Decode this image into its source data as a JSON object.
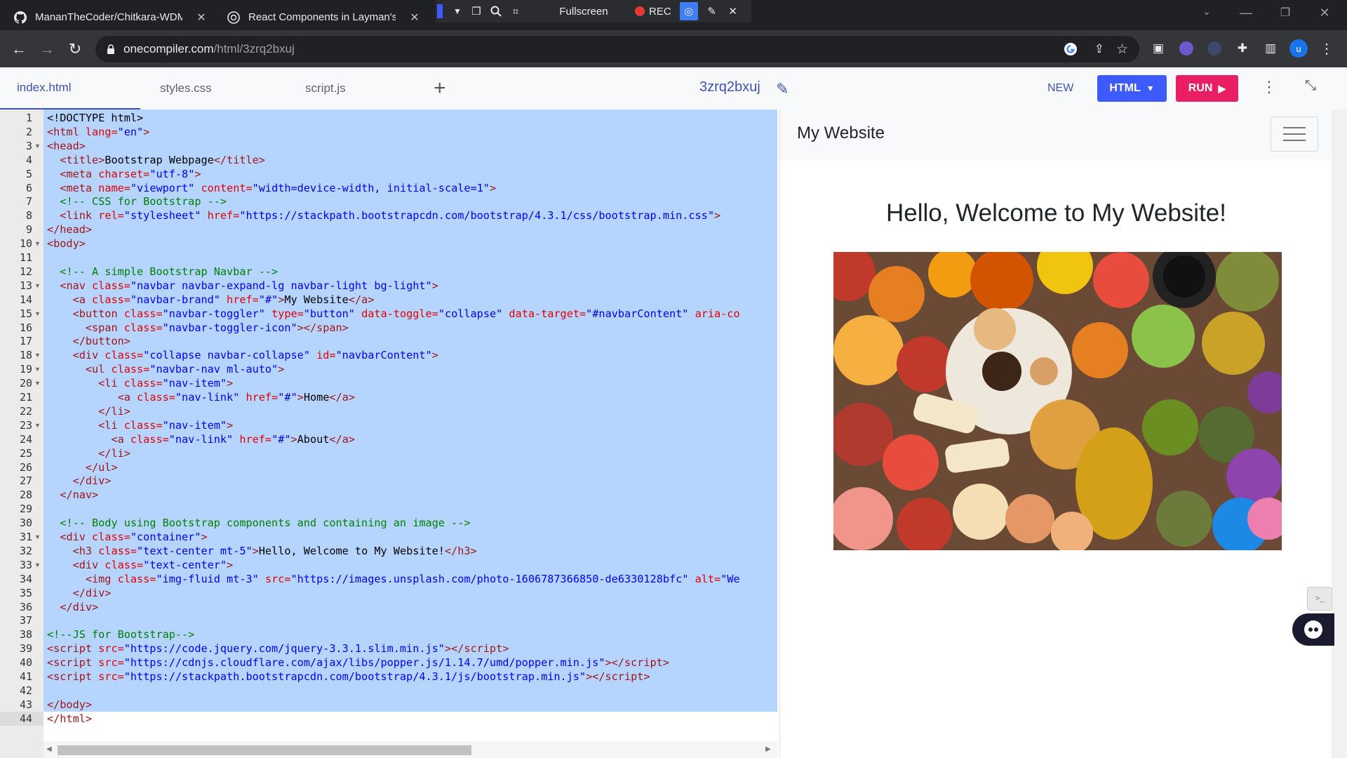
{
  "browser": {
    "tabs": [
      {
        "title": "MananTheCoder/Chitkara-WDM",
        "icon": "github-icon"
      },
      {
        "title": "React Components in Layman's",
        "icon": "chatgpt-icon"
      }
    ],
    "capture_toolbar": {
      "fullscreen_label": "Fullscreen",
      "rec_label": "REC"
    },
    "url_host": "onecompiler.com",
    "url_path": "/html/3zrq2bxuj"
  },
  "editor_tabs": [
    "index.html",
    "styles.css",
    "script.js"
  ],
  "header": {
    "project_name": "3zrq2bxuj",
    "new_label": "NEW",
    "lang_label": "HTML",
    "run_label": "RUN"
  },
  "code_lines": [
    "1",
    "2",
    "3",
    "4",
    "5",
    "6",
    "7",
    "8",
    "9",
    "10",
    "11",
    "12",
    "13",
    "14",
    "15",
    "16",
    "17",
    "18",
    "19",
    "20",
    "21",
    "22",
    "23",
    "24",
    "25",
    "26",
    "27",
    "28",
    "29",
    "30",
    "31",
    "32",
    "33",
    "34",
    "35",
    "36",
    "37",
    "38",
    "39",
    "40",
    "41",
    "42",
    "43",
    "44"
  ],
  "preview": {
    "brand": "My Website",
    "heading": "Hello, Welcome to My Website!"
  },
  "colors": {
    "accent": "#3f51b5",
    "run": "#e91e63",
    "html_button": "#3d5afe",
    "selection": "#b5d5ff"
  }
}
